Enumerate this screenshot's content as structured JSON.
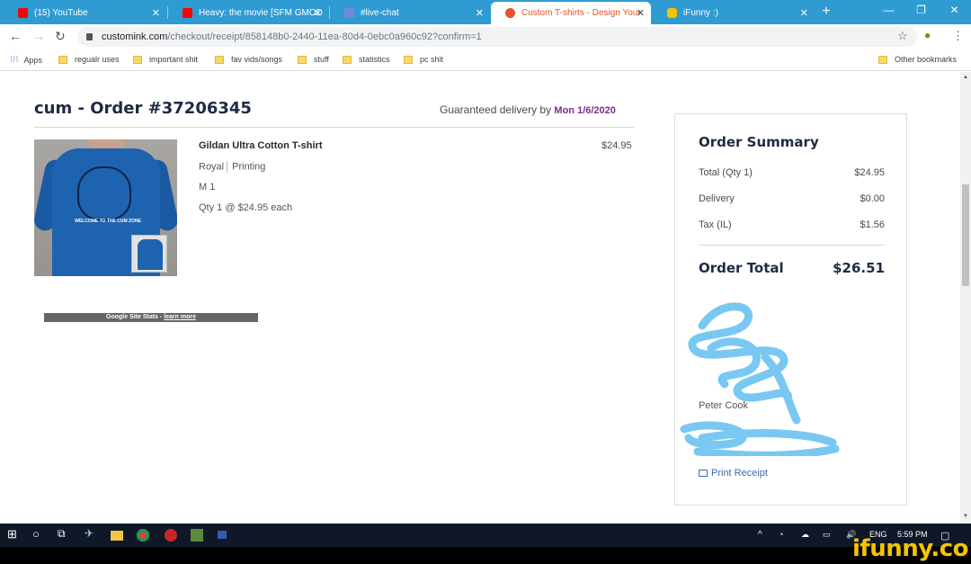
{
  "browser": {
    "tabs": [
      {
        "label": "(15) YouTube",
        "icon": "youtube-icon",
        "active": false
      },
      {
        "label": "Heavy: the movie [SFM GMOD",
        "icon": "youtube-icon",
        "active": false
      },
      {
        "label": "#live-chat",
        "icon": "discord-icon",
        "active": false
      },
      {
        "label": "Custom T-shirts - Design Your",
        "icon": "customink-icon",
        "active": true
      },
      {
        "label": "iFunny :)",
        "icon": "ifunny-icon",
        "active": false
      }
    ],
    "url_host": "customink.com",
    "url_path": "/checkout/receipt/858148b0-2440-11ea-80d4-0ebc0a960c92?confirm=1",
    "bookmarks": [
      "Apps",
      "regualr uses",
      "important shit",
      "fav vids/songs",
      "stuff",
      "statistics",
      "pc shit"
    ],
    "other_bookmarks": "Other bookmarks"
  },
  "order": {
    "title": "cum - Order #37206345",
    "delivery_prefix": "Guaranteed delivery by",
    "delivery_date": "Mon 1/6/2020",
    "item": {
      "name": "Gildan Ultra Cotton T-shirt",
      "price": "$24.95",
      "color": "Royal",
      "method": "Printing",
      "size": "M 1",
      "qty": "Qty 1 @ $24.95 each",
      "print_text": "WELCOME TO THE CUM ZONE"
    },
    "site_stats": "Google Site Stats - ",
    "site_stats_link": "learn more"
  },
  "summary": {
    "title": "Order Summary",
    "rows": [
      {
        "label": "Total (Qty 1)",
        "value": "$24.95"
      },
      {
        "label": "Delivery",
        "value": "$0.00"
      },
      {
        "label": "Tax (IL)",
        "value": "$1.56"
      }
    ],
    "total_label": "Order Total",
    "total_value": "$26.51",
    "name": "Peter Cook",
    "print_label": "Print Receipt"
  },
  "taskbar": {
    "lang": "ENG",
    "time": "5:59 PM"
  },
  "watermark": "ifunny.co",
  "colors": {
    "tabbar": "#2f9bd3",
    "accent_date": "#7a2e8a",
    "link": "#3b6aa8",
    "scribble": "#79c8f2",
    "shirt": "#1e63b0"
  }
}
